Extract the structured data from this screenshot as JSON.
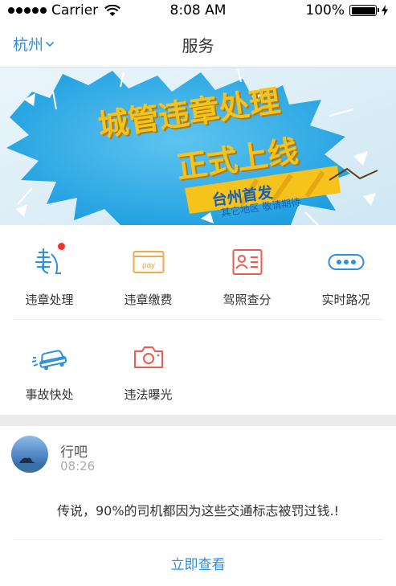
{
  "status_bar": {
    "carrier": "Carrier",
    "time": "8:08 AM",
    "battery": "100%",
    "icons": [
      "signal-dots-icon",
      "wifi-icon",
      "battery-icon",
      "charging-bolt-icon"
    ]
  },
  "nav": {
    "city": "杭州",
    "title": "服务"
  },
  "banner": {
    "headline_line1": "城管违章处理",
    "headline_line2": "正式上线",
    "tag_title": "台州首发",
    "tag_subtitle": "其它地区 敬请期待"
  },
  "services": [
    {
      "label": "违章处理",
      "icon": "violation-icon",
      "badge": true
    },
    {
      "label": "违章缴费",
      "icon": "pay-card-icon",
      "badge": false
    },
    {
      "label": "驾照查分",
      "icon": "license-card-icon",
      "badge": false
    },
    {
      "label": "实时路况",
      "icon": "traffic-dots-icon",
      "badge": false
    },
    {
      "label": "事故快处",
      "icon": "car-accident-icon",
      "badge": false
    },
    {
      "label": "违法曝光",
      "icon": "camera-icon",
      "badge": false
    }
  ],
  "post": {
    "author": "行吧",
    "time": "08:26",
    "text": "传说，90%的司机都因为这些交通标志被罚过钱.!",
    "action": "立即查看"
  },
  "colors": {
    "accent_blue": "#2f8fe0",
    "badge_red": "#f0342a",
    "banner_yellow": "#f6c21c",
    "separator": "#ebebeb"
  }
}
